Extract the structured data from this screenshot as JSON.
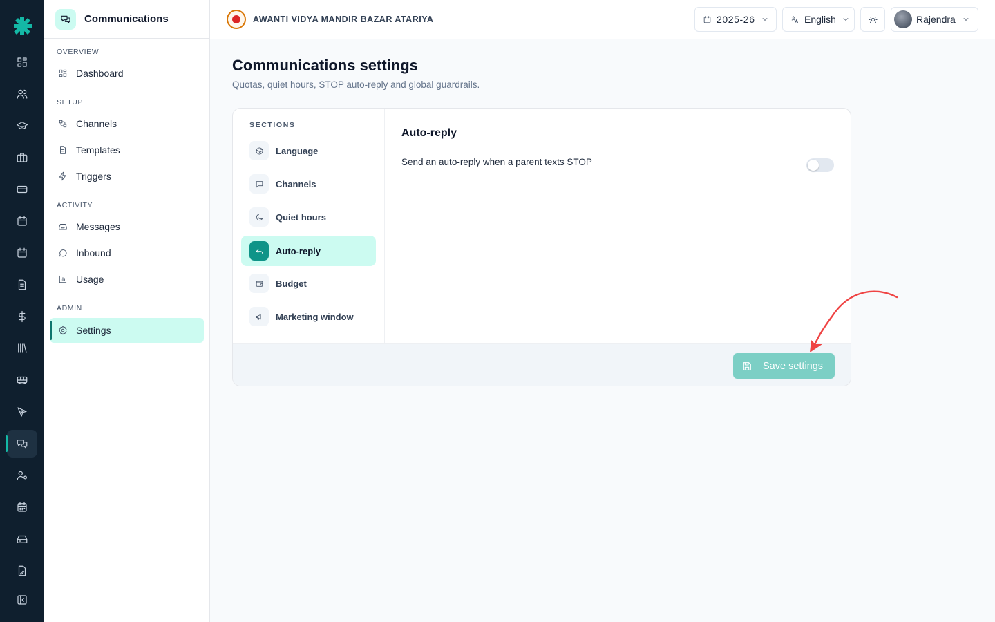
{
  "app": {
    "accent": "#14b8a6",
    "sidebar_bg": "#0f1f2e"
  },
  "rail": {
    "icons": [
      "dashboard-icon",
      "users-icon",
      "graduation-cap-icon",
      "briefcase-icon",
      "credit-card-icon",
      "calendar-icon",
      "calendar-icon",
      "document-icon",
      "dollar-icon",
      "library-icon",
      "bus-icon",
      "pen-tool-icon",
      "chat-icon",
      "user-settings-icon",
      "calendar-grid-icon",
      "storage-icon",
      "file-edit-icon",
      "collapse-icon"
    ],
    "active": "chat-icon"
  },
  "subnav": {
    "title": "Communications",
    "sections": [
      {
        "label": "OVERVIEW",
        "items": [
          {
            "label": "Dashboard",
            "icon": "dashboard-icon"
          }
        ]
      },
      {
        "label": "SETUP",
        "items": [
          {
            "label": "Channels",
            "icon": "channels-icon"
          },
          {
            "label": "Templates",
            "icon": "template-icon"
          },
          {
            "label": "Triggers",
            "icon": "lightning-icon"
          }
        ]
      },
      {
        "label": "ACTIVITY",
        "items": [
          {
            "label": "Messages",
            "icon": "inbox-icon"
          },
          {
            "label": "Inbound",
            "icon": "message-circle-icon"
          },
          {
            "label": "Usage",
            "icon": "bar-chart-icon"
          }
        ]
      },
      {
        "label": "ADMIN",
        "items": [
          {
            "label": "Settings",
            "icon": "gear-icon",
            "active": true
          }
        ]
      }
    ]
  },
  "topbar": {
    "school_name": "AWANTI VIDYA MANDIR BAZAR ATARIYA",
    "year": "2025-26",
    "language": "English",
    "user": "Rajendra"
  },
  "main": {
    "title": "Communications settings",
    "subtitle": "Quotas, quiet hours, STOP auto-reply and global guardrails.",
    "sections_label": "SECTIONS",
    "sections": [
      {
        "label": "Language",
        "icon": "globe-icon"
      },
      {
        "label": "Channels",
        "icon": "message-square-icon"
      },
      {
        "label": "Quiet hours",
        "icon": "moon-icon"
      },
      {
        "label": "Auto-reply",
        "icon": "reply-icon",
        "active": true
      },
      {
        "label": "Budget",
        "icon": "wallet-icon"
      },
      {
        "label": "Marketing window",
        "icon": "megaphone-icon"
      }
    ],
    "panel": {
      "title": "Auto-reply",
      "setting_label": "Send an auto-reply when a parent texts STOP",
      "toggle_on": false
    },
    "save_label": "Save settings"
  }
}
